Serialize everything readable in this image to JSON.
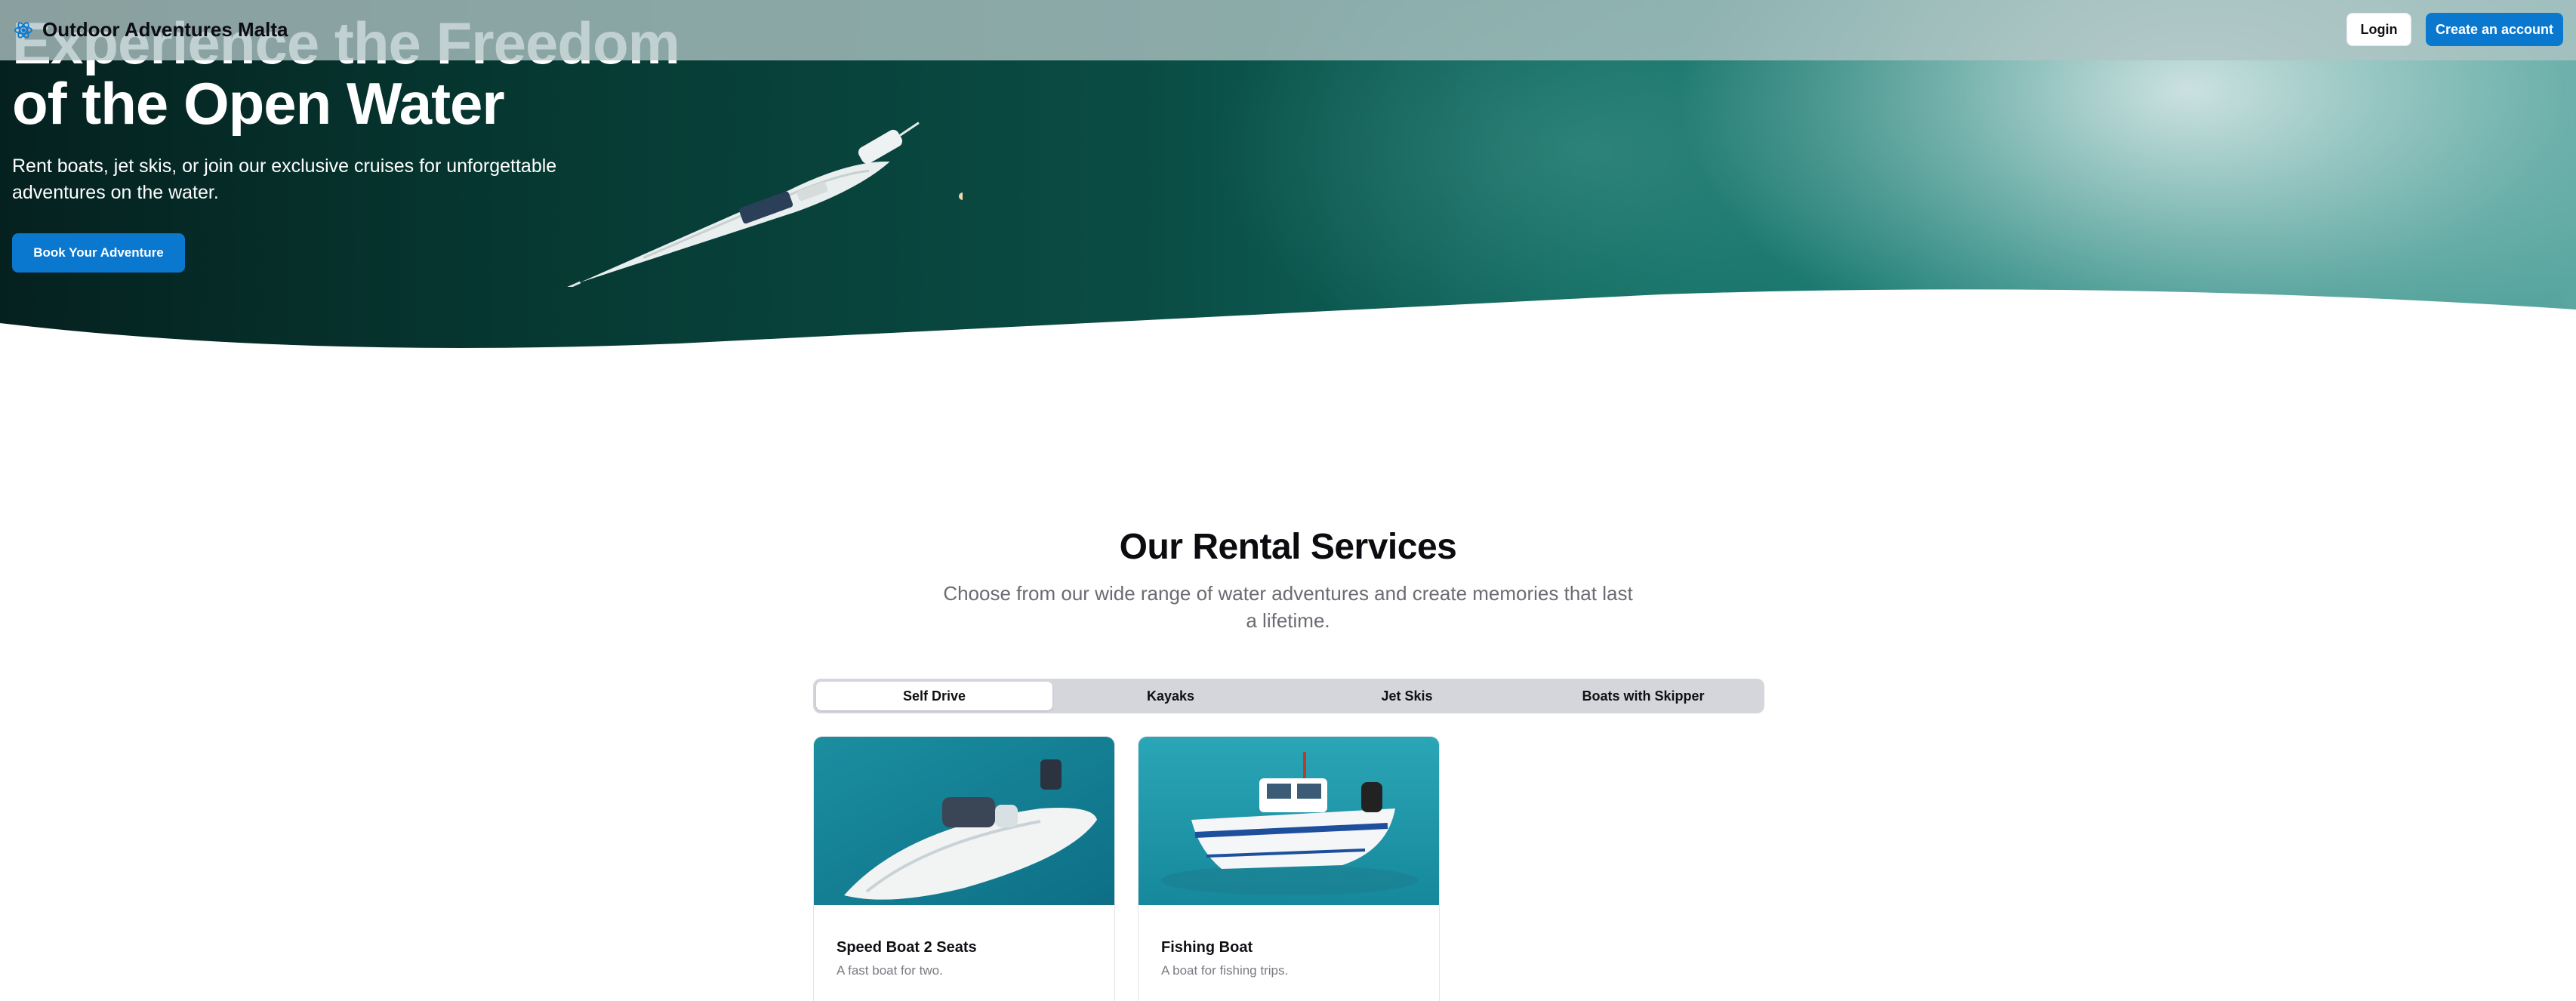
{
  "nav": {
    "brand": "Outdoor Adventures Malta",
    "brand_icon": "atom-icon",
    "login_label": "Login",
    "create_account_label": "Create an account"
  },
  "hero": {
    "title_line1": "Experience the Freedom",
    "title_line2": "of the Open Water",
    "subtitle": "Rent boats, jet skis, or join our exclusive cruises for unforgettable adventures on the water.",
    "cta_label": "Book Your Adventure"
  },
  "services": {
    "title": "Our Rental Services",
    "subtitle": "Choose from our wide range of water adventures and create memories that last a lifetime.",
    "tabs": [
      {
        "label": "Self Drive",
        "active": true
      },
      {
        "label": "Kayaks",
        "active": false
      },
      {
        "label": "Jet Skis",
        "active": false
      },
      {
        "label": "Boats with Skipper",
        "active": false
      }
    ],
    "cards": [
      {
        "title": "Speed Boat 2 Seats",
        "description": "A fast boat for two."
      },
      {
        "title": "Fishing Boat",
        "description": "A boat for fishing trips."
      }
    ]
  },
  "colors": {
    "primary": "#0b78d0",
    "heading": "#0b0b10",
    "muted": "#6b6b73"
  }
}
